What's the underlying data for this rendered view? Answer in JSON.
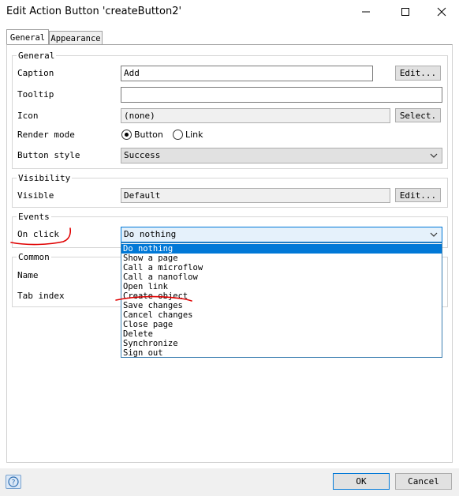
{
  "window": {
    "title": "Edit Action Button 'createButton2'"
  },
  "tabs": [
    {
      "label": "General",
      "active": true
    },
    {
      "label": "Appearance",
      "active": false
    }
  ],
  "general": {
    "group_label": "General",
    "caption_label": "Caption",
    "caption_value": "Add",
    "edit_label": "Edit...",
    "tooltip_label": "Tooltip",
    "tooltip_value": "",
    "icon_label": "Icon",
    "icon_value": "(none)",
    "select_label": "Select.",
    "render_mode_label": "Render mode",
    "render_button_label": "Button",
    "render_link_label": "Link",
    "render_mode_selected": "Button",
    "button_style_label": "Button style",
    "button_style_value": "Success"
  },
  "visibility": {
    "group_label": "Visibility",
    "visible_label": "Visible",
    "visible_value": "Default",
    "edit_label": "Edit..."
  },
  "events": {
    "group_label": "Events",
    "on_click_label": "On click",
    "on_click_value": "Do nothing",
    "options": [
      "Do nothing",
      "Show a page",
      "Call a microflow",
      "Call a nanoflow",
      "Open link",
      "Create object",
      "Save changes",
      "Cancel changes",
      "Close page",
      "Delete",
      "Synchronize",
      "Sign out"
    ],
    "highlighted_option": "Do nothing"
  },
  "common": {
    "group_label": "Common",
    "name_label": "Name",
    "tab_index_label": "Tab index"
  },
  "footer": {
    "ok_label": "OK",
    "cancel_label": "Cancel"
  },
  "colors": {
    "selection": "#0078d7",
    "annotation": "#e00000"
  }
}
